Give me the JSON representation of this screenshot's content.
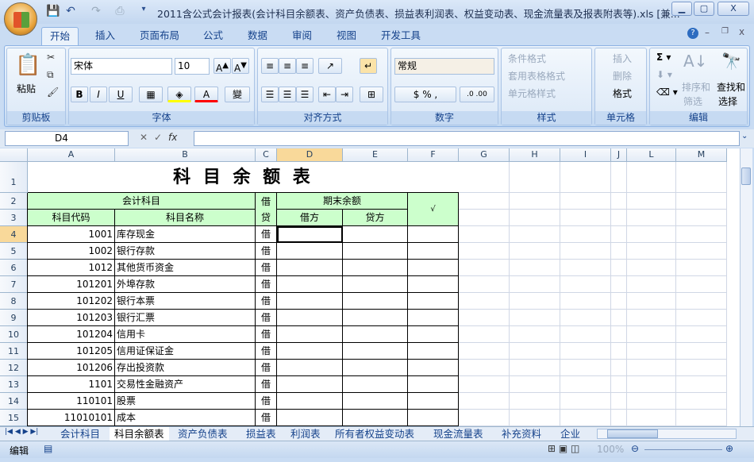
{
  "window": {
    "title": "2011含公式会计报表(会计科目余额表、资产负债表、损益表利润表、权益变动表、现金流量表及报表附表等).xls  [兼..."
  },
  "ribbon_tabs": [
    "开始",
    "插入",
    "页面布局",
    "公式",
    "数据",
    "审阅",
    "视图",
    "开发工具"
  ],
  "ribbon": {
    "clipboard": {
      "label": "剪贴板",
      "paste": "粘贴"
    },
    "font": {
      "label": "字体",
      "name": "宋体",
      "size": "10"
    },
    "alignment": {
      "label": "对齐方式"
    },
    "number": {
      "label": "数字",
      "format": "常规"
    },
    "styles": {
      "label": "样式",
      "items": [
        "条件格式",
        "套用表格格式",
        "单元格样式"
      ]
    },
    "cells": {
      "label": "单元格",
      "items": [
        "插入",
        "删除",
        "格式"
      ]
    },
    "editing": {
      "label": "编辑",
      "sort": "排序和",
      "sort2": "筛选",
      "find": "查找和",
      "find2": "选择"
    }
  },
  "formula_bar": {
    "name_box": "D4",
    "formula": ""
  },
  "columns": [
    "A",
    "B",
    "C",
    "D",
    "E",
    "F",
    "G",
    "H",
    "I",
    "J",
    "L",
    "M"
  ],
  "sheet": {
    "title": "科 目 余 额 表",
    "h_account": "会计科目",
    "h_code": "科目代码",
    "h_name": "科目名称",
    "h_dir": "借\n贷",
    "h_dir1": "借",
    "h_dir2": "贷",
    "h_balance": "期末余额",
    "h_debit": "借方",
    "h_credit": "贷方",
    "h_check": "√",
    "rows": [
      {
        "code": "1001",
        "name": "库存现金",
        "dir": "借"
      },
      {
        "code": "1002",
        "name": "银行存款",
        "dir": "借"
      },
      {
        "code": "1012",
        "name": "其他货币资金",
        "dir": "借"
      },
      {
        "code": "101201",
        "name": "外埠存款",
        "dir": "借"
      },
      {
        "code": "101202",
        "name": "银行本票",
        "dir": "借"
      },
      {
        "code": "101203",
        "name": "银行汇票",
        "dir": "借"
      },
      {
        "code": "101204",
        "name": "信用卡",
        "dir": "借"
      },
      {
        "code": "101205",
        "name": "信用证保证金",
        "dir": "借"
      },
      {
        "code": "101206",
        "name": "存出投资款",
        "dir": "借"
      },
      {
        "code": "1101",
        "name": "交易性金融资产",
        "dir": "借"
      },
      {
        "code": "110101",
        "name": "股票",
        "dir": "借"
      },
      {
        "code": "11010101",
        "name": "成本",
        "dir": "借"
      }
    ]
  },
  "sheet_tabs": [
    "会计科目",
    "科目余额表",
    "资产负债表",
    "损益表",
    "利润表",
    "所有者权益变动表",
    "现金流量表",
    "补充资料",
    "企业"
  ],
  "active_sheet": "科目余额表",
  "status": {
    "mode": "编辑",
    "zoom": "100%"
  }
}
